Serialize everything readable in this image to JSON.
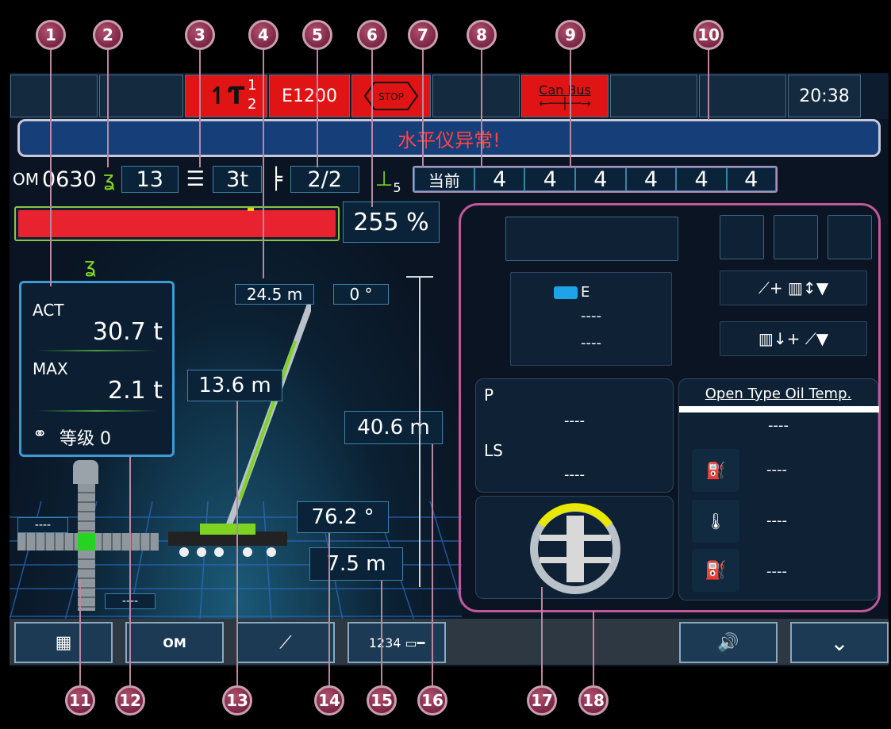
{
  "status_bar": {
    "hook_sup": "1",
    "hook_sub": "2",
    "error_code": "E1200",
    "stop_label": "STOP",
    "canbus_label": "Can Bus",
    "time": "20:38"
  },
  "alarm_message": "水平仪异常!",
  "info_row": {
    "mode_prefix": "OM",
    "mode_code": "0630",
    "hook_reeving": "13",
    "counterweight": "3t",
    "telescope_mode": "2/2",
    "outrigger_sub": "5",
    "current_label": "当前",
    "section_values": [
      "4",
      "4",
      "4",
      "4",
      "4",
      "4"
    ]
  },
  "load_bar": {
    "percent_label": "255 %",
    "fill_fraction": 1.0
  },
  "load_panel": {
    "act_label": "ACT",
    "act_value": "30.7 t",
    "max_label": "MAX",
    "max_value": "2.1 t",
    "level_label": "等级 0"
  },
  "crane": {
    "boom_length": "24.5 m",
    "slew_angle": "0 °",
    "lift_height": "40.6 m",
    "radius_upper": "13.6 m",
    "boom_angle": "76.2 °",
    "radius": "7.5 m",
    "left_readout": "----",
    "bottom_readout": "----"
  },
  "engine_panel": {
    "engine_label": "E",
    "value1": "----",
    "value2": "----"
  },
  "pressure_panel": {
    "p_label": "P",
    "p_value": "----",
    "ls_label": "LS",
    "ls_value": "----"
  },
  "oil_panel": {
    "title": "Open Type Oil Temp.",
    "title_value": "----",
    "oil_value": "----",
    "temp_value": "----",
    "fuel_value": "----"
  },
  "callouts": [
    "1",
    "2",
    "3",
    "4",
    "5",
    "6",
    "7",
    "8",
    "9",
    "10",
    "11",
    "12",
    "13",
    "14",
    "15",
    "16",
    "17",
    "18"
  ],
  "colors": {
    "alarm_red": "#e01414",
    "accent_green": "#7ed321",
    "callout": "#8b2c50",
    "panel_outline": "#c0589a"
  }
}
